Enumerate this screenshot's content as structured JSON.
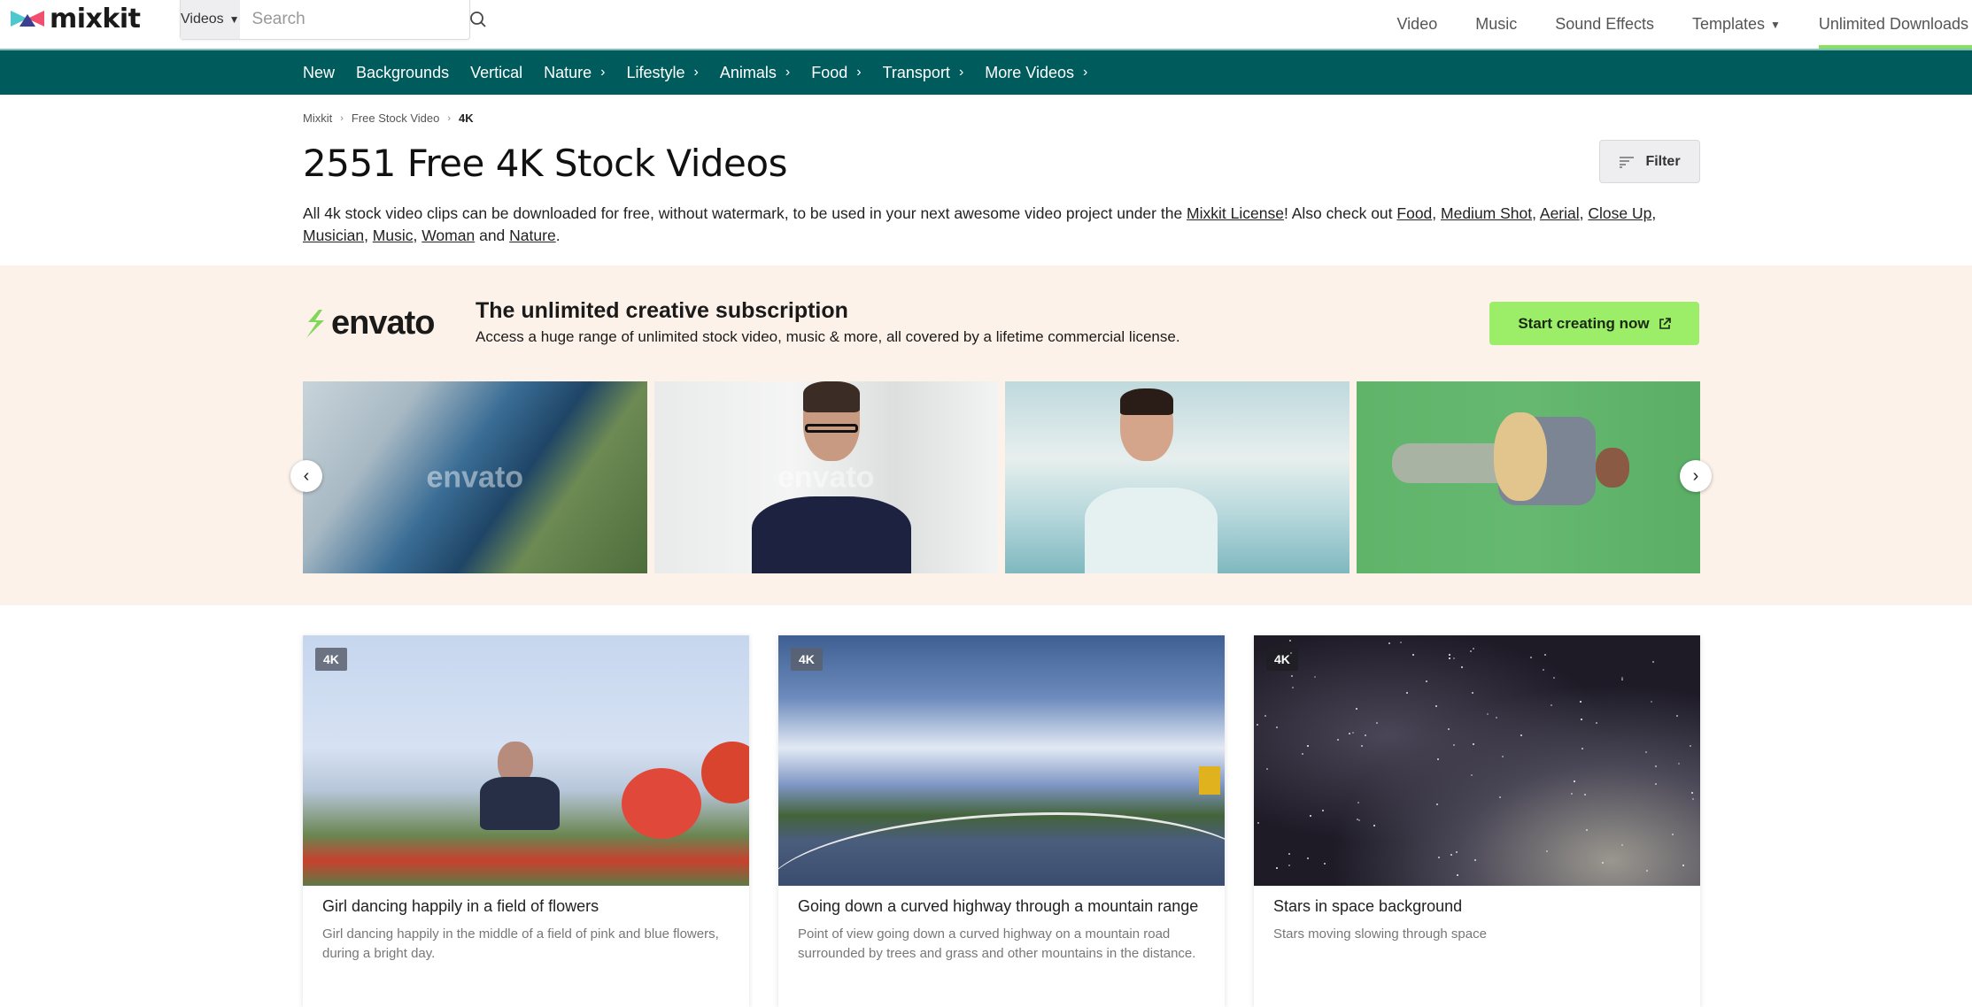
{
  "header": {
    "logo_text": "mixkit",
    "search": {
      "type_label": "Videos",
      "placeholder": "Search",
      "value": ""
    },
    "nav": [
      {
        "label": "Video"
      },
      {
        "label": "Music"
      },
      {
        "label": "Sound Effects"
      },
      {
        "label": "Templates",
        "has_dropdown": true
      },
      {
        "label": "Unlimited Downloads",
        "active": true
      }
    ]
  },
  "category_nav": [
    {
      "label": "New"
    },
    {
      "label": "Backgrounds"
    },
    {
      "label": "Vertical"
    },
    {
      "label": "Nature",
      "has_submenu": true
    },
    {
      "label": "Lifestyle",
      "has_submenu": true
    },
    {
      "label": "Animals",
      "has_submenu": true
    },
    {
      "label": "Food",
      "has_submenu": true
    },
    {
      "label": "Transport",
      "has_submenu": true
    },
    {
      "label": "More Videos",
      "has_submenu": true
    }
  ],
  "breadcrumb": [
    "Mixkit",
    "Free Stock Video",
    "4K"
  ],
  "page": {
    "title": "2551 Free 4K Stock Videos",
    "filter_label": "Filter",
    "intro": {
      "text_1": "All 4k stock video clips can be downloaded for free, without watermark, to be used in your next awesome video project under the ",
      "license_link": "Mixkit License",
      "text_2": "! Also check out ",
      "links": [
        "Food",
        "Medium Shot",
        "Aerial",
        "Close Up",
        "Musician",
        "Music",
        "Woman"
      ],
      "and_text": " and ",
      "last_link": "Nature",
      "end": "."
    }
  },
  "promo": {
    "brand": "envato",
    "title": "The unlimited creative subscription",
    "subtitle": "Access a huge range of unlimited stock video, music & more, all covered by a lifetime commercial license.",
    "cta_label": "Start creating now",
    "watermark": "envato",
    "slides": [
      {
        "alt": "Aerial view of marina with boats"
      },
      {
        "alt": "Man with glasses in office corridor"
      },
      {
        "alt": "Smiling woman at harbor"
      },
      {
        "alt": "Man with guitar on green screen"
      }
    ]
  },
  "videos": [
    {
      "badge": "4K",
      "title": "Girl dancing happily in a field of flowers",
      "description": "Girl dancing happily in the middle of a field of pink and blue flowers, during a bright day."
    },
    {
      "badge": "4K",
      "title": "Going down a curved highway through a mountain range",
      "description": "Point of view going down a curved highway on a mountain road surrounded by trees and grass and other mountains in the distance."
    },
    {
      "badge": "4K",
      "title": "Stars in space background",
      "description": "Stars moving slowing through space"
    }
  ],
  "colors": {
    "category_bar": "#005b5c",
    "active_underline": "#89e05c",
    "promo_bg": "#fdf2ea",
    "cta_bg": "#9cee69"
  }
}
